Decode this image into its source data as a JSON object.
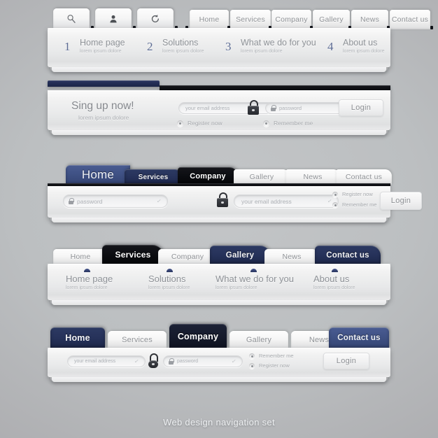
{
  "caption": "Web design navigation set",
  "colors": {
    "navy": "#2a3560",
    "blue": "#3f5184",
    "black": "#0b0c10",
    "light": "#f2f2f2",
    "text_gray": "#8f9296",
    "background": "#b2b5b8"
  },
  "bar1": {
    "icons": [
      {
        "name": "search-icon",
        "glyph": "search"
      },
      {
        "name": "user-icon",
        "glyph": "user"
      },
      {
        "name": "refresh-icon",
        "glyph": "refresh"
      }
    ],
    "tabs": [
      {
        "label": "Home",
        "style": "light"
      },
      {
        "label": "Services",
        "style": "light"
      },
      {
        "label": "Company",
        "style": "light"
      },
      {
        "label": "Gallery",
        "style": "light"
      },
      {
        "label": "News",
        "style": "light"
      },
      {
        "label": "Contact us",
        "style": "light"
      }
    ],
    "menu": [
      {
        "num": "1",
        "title": "Home page",
        "sub": "lorem ipsum dolore"
      },
      {
        "num": "2",
        "title": "Solutions",
        "sub": "lorem ipsum dolore"
      },
      {
        "num": "3",
        "title": "What we do for you",
        "sub": "lorem ipsum dolore"
      },
      {
        "num": "4",
        "title": "About us",
        "sub": "lorem ipsum dolore"
      }
    ]
  },
  "bar2": {
    "heading": "Sing up now!",
    "subheading": "lorem ipsum dolore",
    "email_placeholder": "your email address",
    "password_placeholder": "password",
    "login_label": "Login",
    "radios": [
      {
        "label": "Register now"
      },
      {
        "label": "Remember me"
      }
    ]
  },
  "bar3": {
    "tabs": [
      {
        "label": "Home",
        "style": "blue"
      },
      {
        "label": "Services",
        "style": "dark"
      },
      {
        "label": "Company",
        "style": "black"
      },
      {
        "label": "Gallery",
        "style": "light"
      },
      {
        "label": "News",
        "style": "light"
      },
      {
        "label": "Contact us",
        "style": "light"
      }
    ],
    "password_placeholder": "password",
    "email_placeholder": "your email address",
    "login_label": "Login",
    "radios": [
      {
        "label": "Register now"
      },
      {
        "label": "Remember me"
      }
    ]
  },
  "bar4": {
    "tabs": [
      {
        "label": "Home",
        "style": "light"
      },
      {
        "label": "Services",
        "style": "black"
      },
      {
        "label": "Company",
        "style": "light"
      },
      {
        "label": "Gallery",
        "style": "dark"
      },
      {
        "label": "News",
        "style": "light"
      },
      {
        "label": "Contact us",
        "style": "dark"
      }
    ],
    "menu": [
      {
        "title": "Home page",
        "sub": "lorem ipsum dolore"
      },
      {
        "title": "Solutions",
        "sub": "lorem ipsum dolore"
      },
      {
        "title": "What we do for you",
        "sub": "lorem ipsum dolore"
      },
      {
        "title": "About us",
        "sub": "lorem ipsum dolore"
      }
    ]
  },
  "bar5": {
    "tabs": [
      {
        "label": "Home",
        "style": "dark"
      },
      {
        "label": "Services",
        "style": "light"
      },
      {
        "label": "Company",
        "style": "black"
      },
      {
        "label": "Gallery",
        "style": "light"
      },
      {
        "label": "News",
        "style": "light"
      },
      {
        "label": "Contact us",
        "style": "blue"
      }
    ],
    "email_placeholder": "your email address",
    "password_placeholder": "password",
    "login_label": "Login",
    "radios": [
      {
        "label": "Remember me"
      },
      {
        "label": "Register now"
      }
    ]
  }
}
